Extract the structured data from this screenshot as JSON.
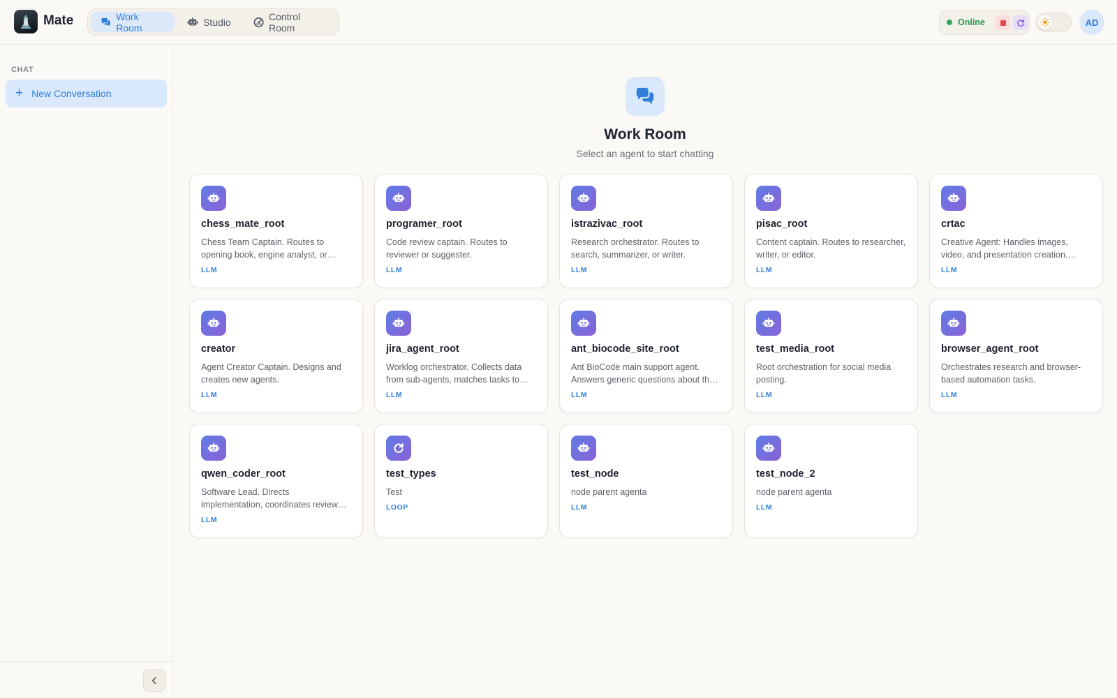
{
  "app": {
    "title": "Mate"
  },
  "nav": {
    "tabs": [
      {
        "label": "Work Room",
        "icon": "chat-bubbles-icon",
        "active": true
      },
      {
        "label": "Studio",
        "icon": "robot-icon",
        "active": false
      },
      {
        "label": "Control Room",
        "icon": "gauge-icon",
        "active": false
      }
    ]
  },
  "status": {
    "label": "Online",
    "color": "#2fa85a"
  },
  "theme_toggle": {
    "mode": "light",
    "icon": "sun-icon"
  },
  "user": {
    "initials": "AD"
  },
  "sidebar": {
    "section_label": "CHAT",
    "new_conversation_label": "New Conversation"
  },
  "main": {
    "title": "Work Room",
    "subtitle": "Select an agent to start chatting",
    "agents": [
      {
        "name": "chess_mate_root",
        "description": "Chess Team Captain. Routes to opening book, engine analyst, or endgame specialist.",
        "type": "LLM",
        "icon": "robot-icon"
      },
      {
        "name": "programer_root",
        "description": "Code review captain. Routes to reviewer or suggester.",
        "type": "LLM",
        "icon": "robot-icon"
      },
      {
        "name": "istrazivac_root",
        "description": "Research orchestrator. Routes to search, summarizer, or writer.",
        "type": "LLM",
        "icon": "robot-icon"
      },
      {
        "name": "pisac_root",
        "description": "Content captain. Routes to researcher, writer, or editor.",
        "type": "LLM",
        "icon": "robot-icon"
      },
      {
        "name": "crtac",
        "description": "Creative Agent: Handles images, video, and presentation creation. Delegates to specialists.",
        "type": "LLM",
        "icon": "robot-icon"
      },
      {
        "name": "creator",
        "description": "Agent Creator Captain. Designs and creates new agents.",
        "type": "LLM",
        "icon": "robot-icon"
      },
      {
        "name": "jira_agent_root",
        "description": "Worklog orchestrator. Collects data from sub-agents, matches tasks to tickets.",
        "type": "LLM",
        "icon": "robot-icon"
      },
      {
        "name": "ant_biocode_site_root",
        "description": "Ant BioCode main support agent. Answers generic questions about the site.",
        "type": "LLM",
        "icon": "robot-icon"
      },
      {
        "name": "test_media_root",
        "description": "Root orchestration for social media posting.",
        "type": "LLM",
        "icon": "robot-icon"
      },
      {
        "name": "browser_agent_root",
        "description": "Orchestrates research and browser-based automation tasks.",
        "type": "LLM",
        "icon": "robot-icon"
      },
      {
        "name": "qwen_coder_root",
        "description": "Software Lead. Directs implementation, coordinates reviewers and testers.",
        "type": "LLM",
        "icon": "robot-icon"
      },
      {
        "name": "test_types",
        "description": "Test",
        "type": "LOOP",
        "icon": "refresh-icon"
      },
      {
        "name": "test_node",
        "description": "node parent agenta",
        "type": "LLM",
        "icon": "robot-icon"
      },
      {
        "name": "test_node_2",
        "description": "node parent agenta",
        "type": "LLM",
        "icon": "robot-icon"
      }
    ]
  },
  "colors": {
    "accent": "#2f7fd8",
    "accent_bg": "#d9e8fb",
    "online": "#2fa85a",
    "stop": "#e04848",
    "card_icon_gradient": [
      "#5f7ce6",
      "#8a62d6"
    ]
  }
}
